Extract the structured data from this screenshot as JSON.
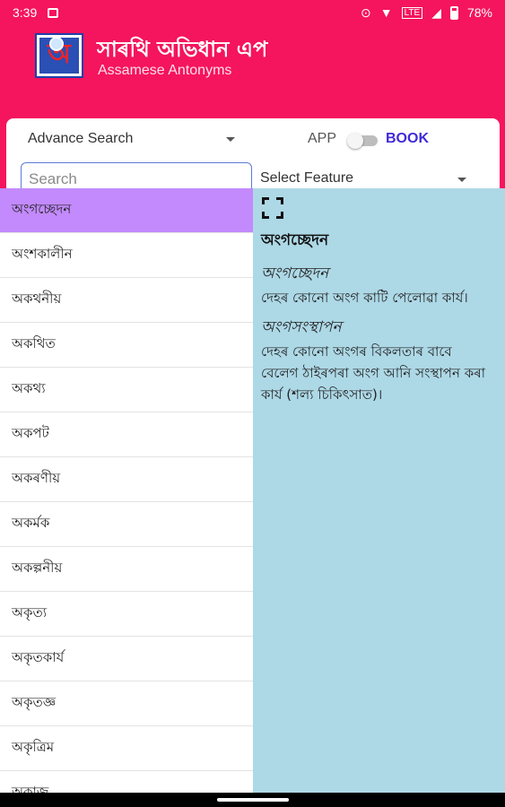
{
  "status_bar": {
    "time": "3:39",
    "battery": "78%",
    "icons": [
      "image-icon",
      "sync-icon",
      "wifi-icon",
      "lte-icon",
      "signal-icon",
      "battery-icon"
    ]
  },
  "header": {
    "title": "সাৰথি অভিধান এপ",
    "subtitle": "Assamese Antonyms",
    "logo_letter": "অ"
  },
  "search_panel": {
    "advance_search_label": "Advance Search",
    "app_label": "APP",
    "book_label": "BOOK",
    "search_placeholder": "Search",
    "search_value": "",
    "select_feature_label": "Select Feature",
    "accent_color": "#3f2ad8",
    "toggle_on": false
  },
  "word_list": {
    "items": [
      "অংগচ্ছেদন",
      "অংশকালীন",
      "অকথনীয়",
      "অকথিত",
      "অকথ্য",
      "অকপট",
      "অকৰণীয়",
      "অকৰ্মক",
      "অকল্পনীয়",
      "অকৃত্য",
      "অকৃতকাৰ্য",
      "অকৃতজ্ঞ",
      "অকৃত্ৰিম",
      "অকাজ"
    ],
    "selected_index": 0
  },
  "detail": {
    "headword": "অংগচ্ছেদন",
    "entries": [
      {
        "term": "অংগচ্ছেদন",
        "definition": "দেহৰ কোনো অংগ কাটি পেলোৱা কাৰ্য।"
      },
      {
        "term": "অংগসংস্থাপন",
        "definition": "দেহৰ কোনো অংগৰ বিকলতাৰ বাবে বেলেগ ঠাইৰপৰা অংগ আনি সংস্থাপন কৰা কাৰ্য (শল্য চিকিৎসাত)।"
      }
    ]
  },
  "colors": {
    "brand": "#f5145e",
    "selected_row": "#c28afc",
    "detail_bg": "#add8e6"
  }
}
